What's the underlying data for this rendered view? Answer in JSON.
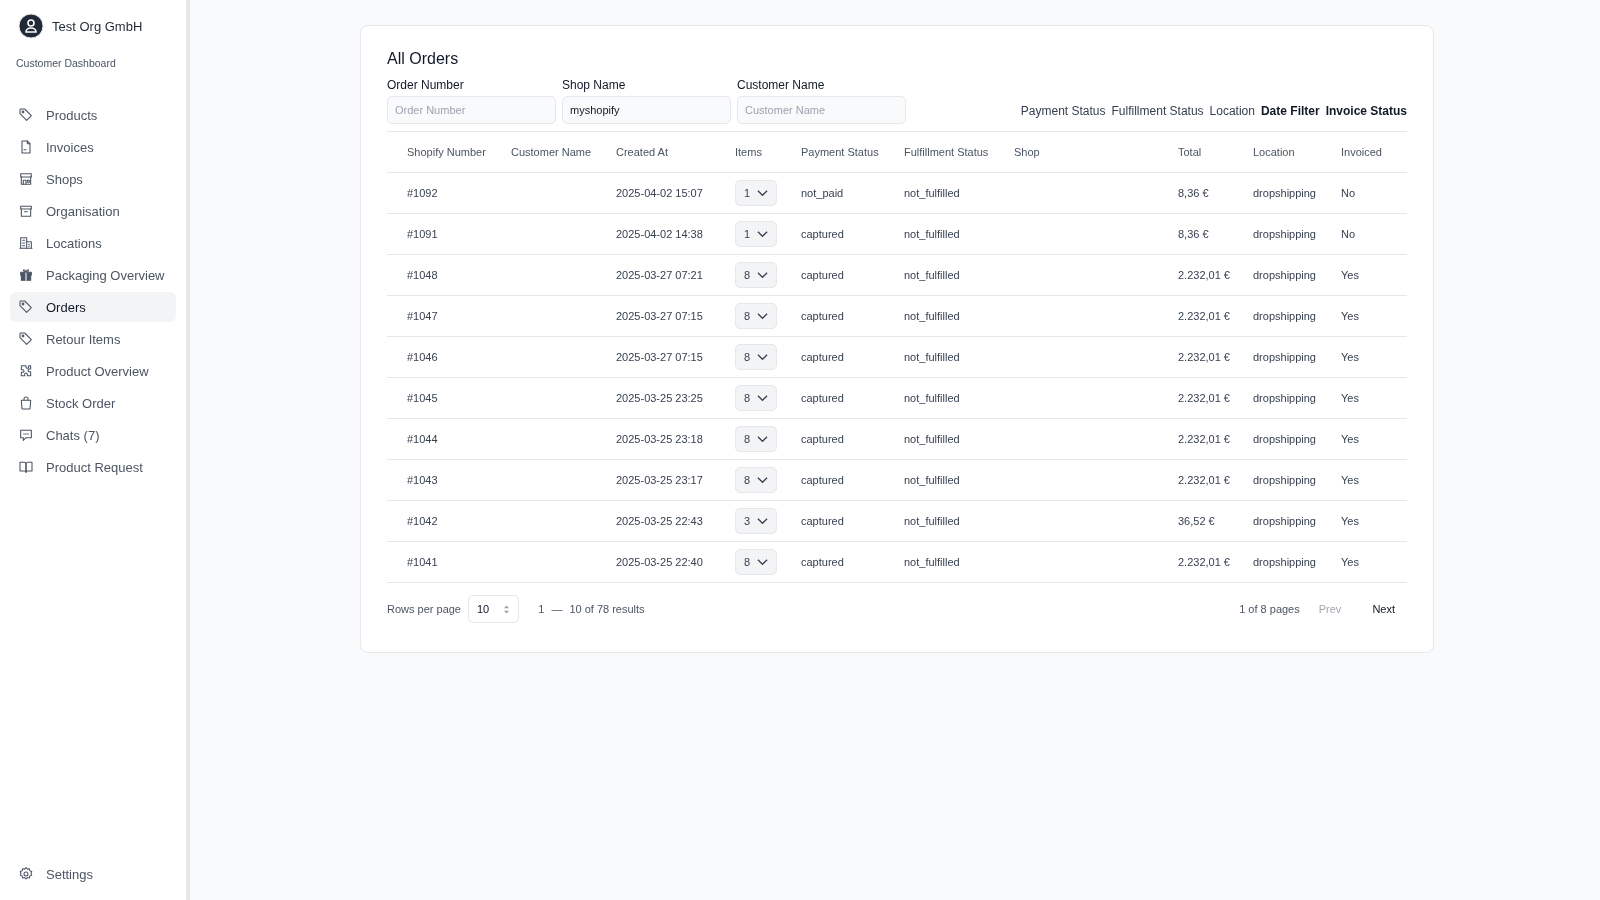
{
  "sidebar": {
    "org_name": "Test Org GmbH",
    "subtitle": "Customer Dashboard",
    "items": [
      {
        "label": "Products",
        "selected": false
      },
      {
        "label": "Invoices",
        "selected": false
      },
      {
        "label": "Shops",
        "selected": false
      },
      {
        "label": "Organisation",
        "selected": false
      },
      {
        "label": "Locations",
        "selected": false
      },
      {
        "label": "Packaging Overview",
        "selected": false
      },
      {
        "label": "Orders",
        "selected": true
      },
      {
        "label": "Retour Items",
        "selected": false
      },
      {
        "label": "Product Overview",
        "selected": false
      },
      {
        "label": "Stock Order",
        "selected": false
      },
      {
        "label": "Chats (7)",
        "selected": false
      },
      {
        "label": "Product Request",
        "selected": false
      }
    ],
    "footer_item": {
      "label": "Settings"
    }
  },
  "card": {
    "title": "All Orders",
    "fields": [
      {
        "label": "Order Number",
        "placeholder": "Order Number"
      },
      {
        "label": "Shop Name",
        "value": "myshopify"
      },
      {
        "label": "Customer Name",
        "placeholder": "Customer Name"
      }
    ],
    "filters": [
      {
        "label": "Payment Status",
        "active": false
      },
      {
        "label": "Fulfillment Status",
        "active": false
      },
      {
        "label": "Location",
        "active": false
      },
      {
        "label": "Date Filter",
        "active": true
      },
      {
        "label": "Invoice Status",
        "active": true
      }
    ],
    "table": {
      "columns": [
        "Shopify Number",
        "Customer Name",
        "Created At",
        "Items",
        "Payment Status",
        "Fulfillment Status",
        "Shop",
        "Total",
        "Location",
        "Invoiced"
      ],
      "rows": [
        {
          "shopify_number": "#1092",
          "created_at": "2025-04-02 15:07",
          "items": "1",
          "payment_status": "not_paid",
          "fulfillment_status": "not_fulfilled",
          "total": "8,36 €",
          "location": "dropshipping",
          "invoiced": "No"
        },
        {
          "shopify_number": "#1091",
          "created_at": "2025-04-02 14:38",
          "items": "1",
          "payment_status": "captured",
          "fulfillment_status": "not_fulfilled",
          "total": "8,36 €",
          "location": "dropshipping",
          "invoiced": "No"
        },
        {
          "shopify_number": "#1048",
          "created_at": "2025-03-27 07:21",
          "items": "8",
          "payment_status": "captured",
          "fulfillment_status": "not_fulfilled",
          "total": "2.232,01 €",
          "location": "dropshipping",
          "invoiced": "Yes"
        },
        {
          "shopify_number": "#1047",
          "created_at": "2025-03-27 07:15",
          "items": "8",
          "payment_status": "captured",
          "fulfillment_status": "not_fulfilled",
          "total": "2.232,01 €",
          "location": "dropshipping",
          "invoiced": "Yes"
        },
        {
          "shopify_number": "#1046",
          "created_at": "2025-03-27 07:15",
          "items": "8",
          "payment_status": "captured",
          "fulfillment_status": "not_fulfilled",
          "total": "2.232,01 €",
          "location": "dropshipping",
          "invoiced": "Yes"
        },
        {
          "shopify_number": "#1045",
          "created_at": "2025-03-25 23:25",
          "items": "8",
          "payment_status": "captured",
          "fulfillment_status": "not_fulfilled",
          "total": "2.232,01 €",
          "location": "dropshipping",
          "invoiced": "Yes"
        },
        {
          "shopify_number": "#1044",
          "created_at": "2025-03-25 23:18",
          "items": "8",
          "payment_status": "captured",
          "fulfillment_status": "not_fulfilled",
          "total": "2.232,01 €",
          "location": "dropshipping",
          "invoiced": "Yes"
        },
        {
          "shopify_number": "#1043",
          "created_at": "2025-03-25 23:17",
          "items": "8",
          "payment_status": "captured",
          "fulfillment_status": "not_fulfilled",
          "total": "2.232,01 €",
          "location": "dropshipping",
          "invoiced": "Yes"
        },
        {
          "shopify_number": "#1042",
          "created_at": "2025-03-25 22:43",
          "items": "3",
          "payment_status": "captured",
          "fulfillment_status": "not_fulfilled",
          "total": "36,52 €",
          "location": "dropshipping",
          "invoiced": "Yes"
        },
        {
          "shopify_number": "#1041",
          "created_at": "2025-03-25 22:40",
          "items": "8",
          "payment_status": "captured",
          "fulfillment_status": "not_fulfilled",
          "total": "2.232,01 €",
          "location": "dropshipping",
          "invoiced": "Yes"
        }
      ]
    },
    "pagination": {
      "rows_per_page_label": "Rows per page",
      "rows_per_page": "10",
      "range_start": "1",
      "range_dash": "—",
      "range_rest": "10 of 78 results",
      "pages": "1 of 8 pages",
      "prev": {
        "label": "Prev",
        "disabled": true
      },
      "next": {
        "label": "Next",
        "disabled": false
      }
    }
  }
}
